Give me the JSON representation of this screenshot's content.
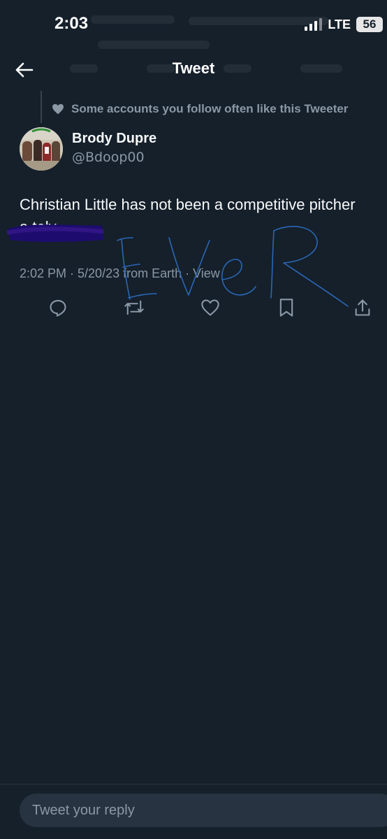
{
  "status_bar": {
    "time": "2:03",
    "network": "LTE",
    "battery": "56"
  },
  "nav": {
    "title": "Tweet"
  },
  "social_context": {
    "text": "Some accounts you follow often like this Tweeter"
  },
  "tweet": {
    "author_name": "Brody Dupre",
    "author_handle": "@Bdoop00",
    "text_line1": "Christian Little has not been a competitive pitcher",
    "text_line2": "a        tely",
    "meta": "2:02 PM · 5/20/23 from Earth · View"
  },
  "scribble_text": "EVER",
  "actions": [
    {
      "icon": "reply-icon"
    },
    {
      "icon": "retweet-icon"
    },
    {
      "icon": "like-icon"
    },
    {
      "icon": "bookmark-icon"
    },
    {
      "icon": "share-icon"
    }
  ],
  "reply": {
    "placeholder": "Tweet your reply"
  },
  "colors": {
    "background": "#15202b",
    "secondary_text": "#8b98a5",
    "redaction": "#1d0c6e",
    "scribble": "#2b67b5"
  }
}
